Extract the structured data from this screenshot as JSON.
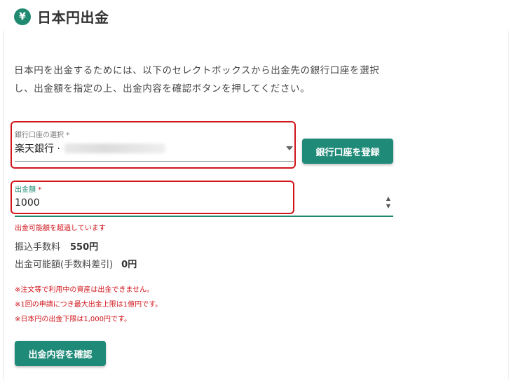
{
  "header": {
    "title": "日本円出金",
    "icon": "yen-icon",
    "icon_glyph": "¥"
  },
  "intro": {
    "line1": "日本円を出金するためには、以下のセレクトボックスから出金先の銀行口座を選択",
    "line2": "し、出金額を指定の上、出金内容を確認ボタンを押してください。"
  },
  "bank_select": {
    "label": "銀行口座の選択 *",
    "value": "楽天銀行 ·"
  },
  "register_button": {
    "label": "銀行口座を登録"
  },
  "amount": {
    "label": "出金額",
    "required_mark": "*",
    "value": "1000"
  },
  "error": {
    "message": "出金可能額を超過しています"
  },
  "fee": {
    "label": "振込手数料",
    "value": "550円"
  },
  "available": {
    "label": "出金可能額(手数料差引)",
    "value": "0円"
  },
  "notes": [
    "※注文等で利用中の資産は出金できません。",
    "※1回の申請につき最大出金上限は1億円です。",
    "※日本円の出金下限は1,000円です。"
  ],
  "confirm_button": {
    "label": "出金内容を確認"
  },
  "colors": {
    "accent": "#1f8a78",
    "error": "#d0151b"
  }
}
